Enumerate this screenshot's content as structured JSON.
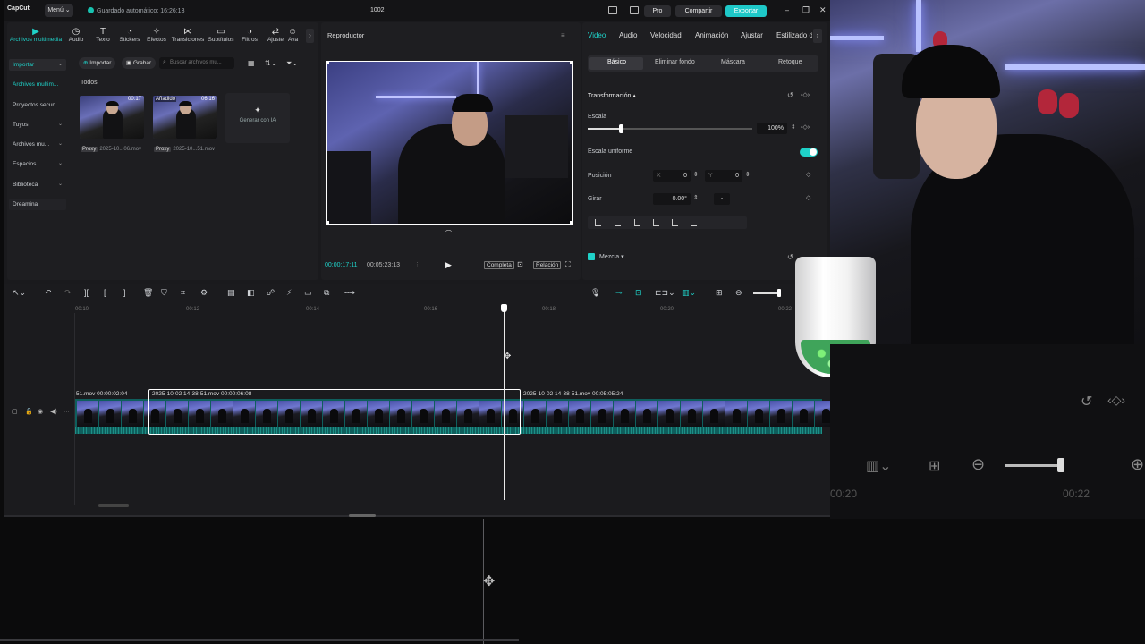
{
  "topbar": {
    "logo": "CapCut",
    "menu": "Menú ⌄",
    "saved": "Guardado automático: 16:26:13",
    "project_title": "1002",
    "pro": "Pro",
    "share": "Compartir",
    "export": "Exportar",
    "accent": "#1ec8c8"
  },
  "tool_tabs": [
    {
      "label": "Archivos multimedia",
      "icon": "media-icon"
    },
    {
      "label": "Audio",
      "icon": "audio-icon"
    },
    {
      "label": "Texto",
      "icon": "text-icon"
    },
    {
      "label": "Stickers",
      "icon": "sticker-icon"
    },
    {
      "label": "Efectos",
      "icon": "effects-icon"
    },
    {
      "label": "Transiciones",
      "icon": "transitions-icon"
    },
    {
      "label": "Subtítulos",
      "icon": "subtitles-icon"
    },
    {
      "label": "Filtros",
      "icon": "filters-icon"
    },
    {
      "label": "Ajuste",
      "icon": "adjust-icon"
    },
    {
      "label": "Ava",
      "icon": "avatar-icon"
    }
  ],
  "sidebar": {
    "items": [
      {
        "label": "Importar"
      },
      {
        "label": "Archivos multim..."
      },
      {
        "label": "Proyectos secun..."
      },
      {
        "label": "Tuyos"
      },
      {
        "label": "Archivos mu..."
      },
      {
        "label": "Espacios"
      },
      {
        "label": "Biblioteca"
      },
      {
        "label": "Dreamina"
      }
    ]
  },
  "media": {
    "import_btn": "Importar",
    "record_btn": "Grabar",
    "search_placeholder": "Buscar archivos mu...",
    "filter_all": "Todos",
    "clips": [
      {
        "name": "2025-10...06.mov",
        "duration": "00:17",
        "proxy": "Proxy",
        "badge": ""
      },
      {
        "name": "2025-10...51.mov",
        "duration": "06:16",
        "proxy": "Proxy",
        "badge": "Añadido"
      }
    ],
    "generate_ai": "Generar con IA"
  },
  "player": {
    "title": "Reproductor",
    "current_time": "00:00:17:11",
    "total_time": "00:05:23:13",
    "full_btn": "Completa",
    "ratio_btn": "Relación"
  },
  "properties": {
    "tabs": [
      "Video",
      "Audio",
      "Velocidad",
      "Animación",
      "Ajustar",
      "Estilizado d"
    ],
    "sub_tabs": [
      "Básico",
      "Eliminar fondo",
      "Máscara",
      "Retoque"
    ],
    "transform_label": "Transformación",
    "scale_label": "Escala",
    "scale_value": "100%",
    "scale_fraction": 0.2,
    "uniform_scale_label": "Escala uniforme",
    "position_label": "Posición",
    "pos_x_label": "X",
    "pos_x": "0",
    "pos_y_label": "Y",
    "pos_y": "0",
    "rotate_label": "Girar",
    "rotate_value": "0.00°",
    "rotate_dash": "-",
    "blend_label": "Mezcla"
  },
  "timeline": {
    "ruler": [
      "00:10",
      "00:12",
      "00:14",
      "00:16",
      "00:18",
      "00:20",
      "00:22"
    ],
    "clips": [
      {
        "label": "51.mov   00:00:02:04"
      },
      {
        "label": "2025-10-02 14-38-51.mov   00:00:06:08"
      },
      {
        "label": "2025-10-02 14-38-51.mov   00:05:05:24"
      }
    ]
  },
  "webcam_overlay_readout": {
    "ruler_a": "00:20",
    "ruler_b": "00:22"
  }
}
